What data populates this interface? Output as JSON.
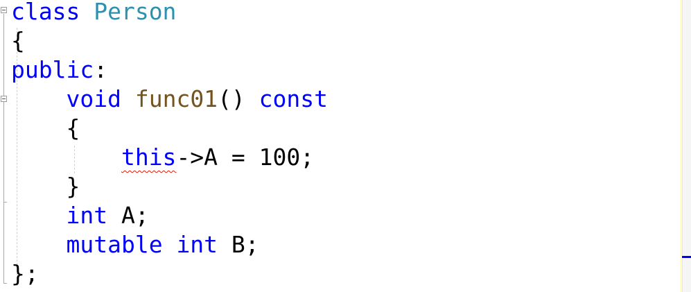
{
  "editor": {
    "lines": [
      {
        "indent": "",
        "tokens": [
          {
            "t": "class",
            "c": "kw"
          },
          {
            "t": " ",
            "c": "plain"
          },
          {
            "t": "Person",
            "c": "type"
          }
        ]
      },
      {
        "indent": "",
        "tokens": [
          {
            "t": "{",
            "c": "plain"
          }
        ]
      },
      {
        "indent": "",
        "tokens": [
          {
            "t": "public",
            "c": "kw"
          },
          {
            "t": ":",
            "c": "plain"
          }
        ]
      },
      {
        "indent": "    ",
        "tokens": [
          {
            "t": "void",
            "c": "kw"
          },
          {
            "t": " ",
            "c": "plain"
          },
          {
            "t": "func01",
            "c": "fn"
          },
          {
            "t": "() ",
            "c": "plain"
          },
          {
            "t": "const",
            "c": "kw"
          }
        ]
      },
      {
        "indent": "    ",
        "tokens": [
          {
            "t": "{",
            "c": "plain"
          }
        ]
      },
      {
        "indent": "        ",
        "tokens": [
          {
            "t": "this",
            "c": "kw",
            "err": true
          },
          {
            "t": "->A = 100;",
            "c": "plain"
          }
        ]
      },
      {
        "indent": "    ",
        "tokens": [
          {
            "t": "}",
            "c": "plain"
          }
        ]
      },
      {
        "indent": "    ",
        "tokens": [
          {
            "t": "int",
            "c": "kw"
          },
          {
            "t": " A;",
            "c": "plain"
          }
        ]
      },
      {
        "indent": "    ",
        "tokens": [
          {
            "t": "mutable",
            "c": "kw"
          },
          {
            "t": " ",
            "c": "plain"
          },
          {
            "t": "int",
            "c": "kw"
          },
          {
            "t": " B;",
            "c": "plain"
          }
        ]
      },
      {
        "indent": "",
        "tokens": [
          {
            "t": "};",
            "c": "plain"
          }
        ]
      }
    ]
  },
  "colors": {
    "keyword": "#0000ff",
    "type": "#2b91af",
    "function": "#74531f",
    "text": "#000000",
    "error_squiggle": "#e51400",
    "scroll_marker": "#0000ff"
  }
}
